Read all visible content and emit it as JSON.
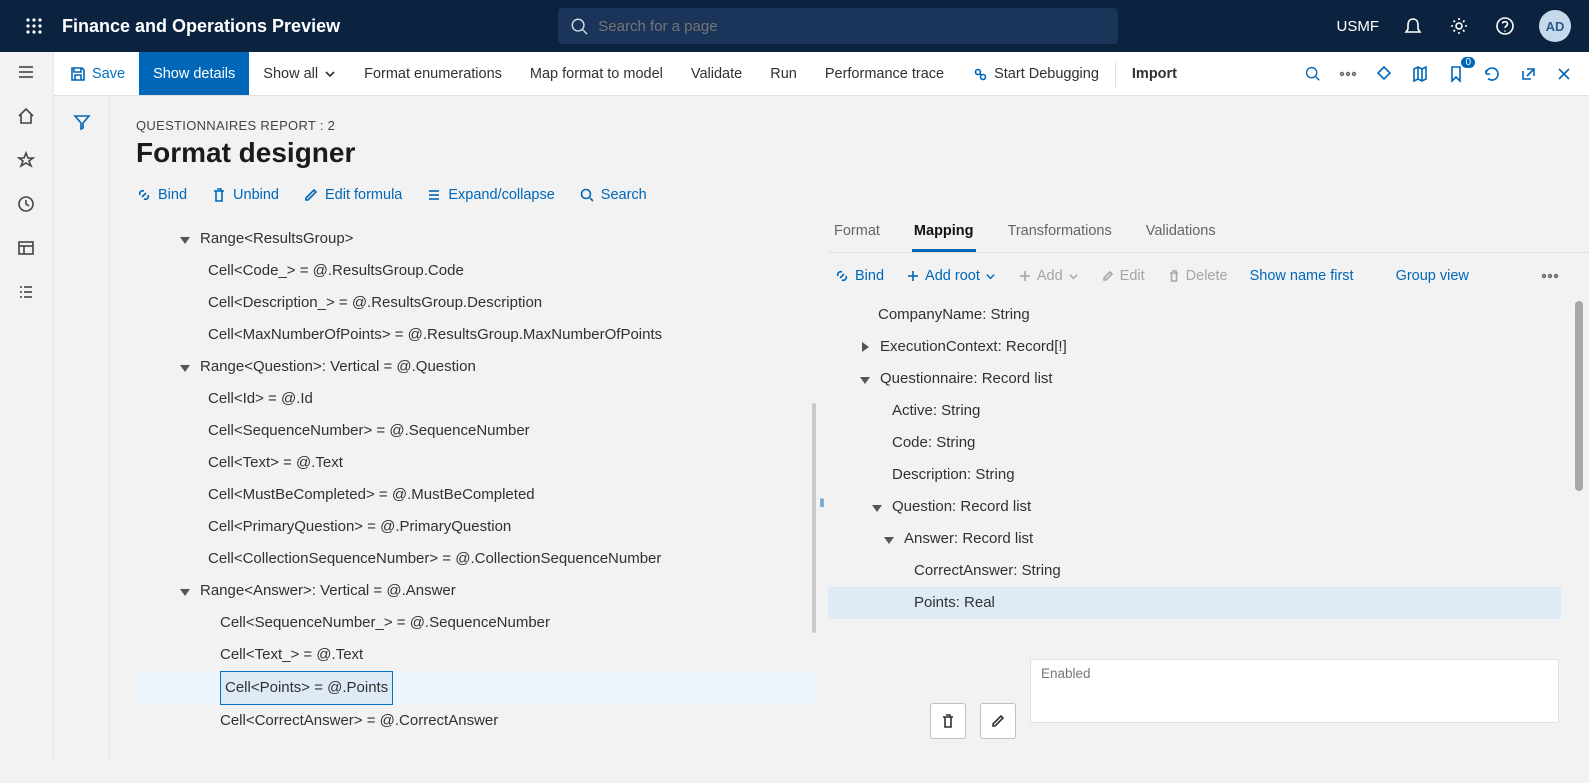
{
  "topbar": {
    "brand": "Finance and Operations Preview",
    "search_placeholder": "Search for a page",
    "company": "USMF",
    "avatar": "AD"
  },
  "cmdbar": {
    "save": "Save",
    "show_details": "Show details",
    "show_all": "Show all",
    "format_enum": "Format enumerations",
    "map_format": "Map format to model",
    "validate": "Validate",
    "run": "Run",
    "perf": "Performance trace",
    "debug": "Start Debugging",
    "import": "Import",
    "badge": "0"
  },
  "page": {
    "breadcrumb": "QUESTIONNAIRES REPORT : 2",
    "title": "Format designer"
  },
  "toolbar": {
    "bind": "Bind",
    "unbind": "Unbind",
    "edit_formula": "Edit formula",
    "expand": "Expand/collapse",
    "search": "Search"
  },
  "format_tree": {
    "r1": "Range<ResultsGroup>",
    "r1a": "Cell<Code_> = @.ResultsGroup.Code",
    "r1b": "Cell<Description_> = @.ResultsGroup.Description",
    "r1c": "Cell<MaxNumberOfPoints> = @.ResultsGroup.MaxNumberOfPoints",
    "r2": "Range<Question>: Vertical = @.Question",
    "r2a": "Cell<Id> = @.Id",
    "r2b": "Cell<SequenceNumber> = @.SequenceNumber",
    "r2c": "Cell<Text> = @.Text",
    "r2d": "Cell<MustBeCompleted> = @.MustBeCompleted",
    "r2e": "Cell<PrimaryQuestion> = @.PrimaryQuestion",
    "r2f": "Cell<CollectionSequenceNumber> = @.CollectionSequenceNumber",
    "r3": "Range<Answer>: Vertical = @.Answer",
    "r3a": "Cell<SequenceNumber_> = @.SequenceNumber",
    "r3b": "Cell<Text_> = @.Text",
    "r3c": "Cell<Points> = @.Points",
    "r3d": "Cell<CorrectAnswer> = @.CorrectAnswer"
  },
  "rtabs": {
    "format": "Format",
    "mapping": "Mapping",
    "transformations": "Transformations",
    "validations": "Validations"
  },
  "rtoolbar": {
    "bind": "Bind",
    "add_root": "Add root",
    "add": "Add",
    "edit": "Edit",
    "delete": "Delete",
    "show_name": "Show name first",
    "group": "Group view"
  },
  "mapping_tree": {
    "m1": "CompanyName: String",
    "m2": "ExecutionContext: Record[!]",
    "m3": "Questionnaire: Record list",
    "m3a": "Active: String",
    "m3b": "Code: String",
    "m3c": "Description: String",
    "m3d": "Question: Record list",
    "m3d1": "Answer: Record list",
    "m3d1a": "CorrectAnswer: String",
    "m3d1b": "Points: Real"
  },
  "bottom": {
    "enabled": "Enabled"
  }
}
